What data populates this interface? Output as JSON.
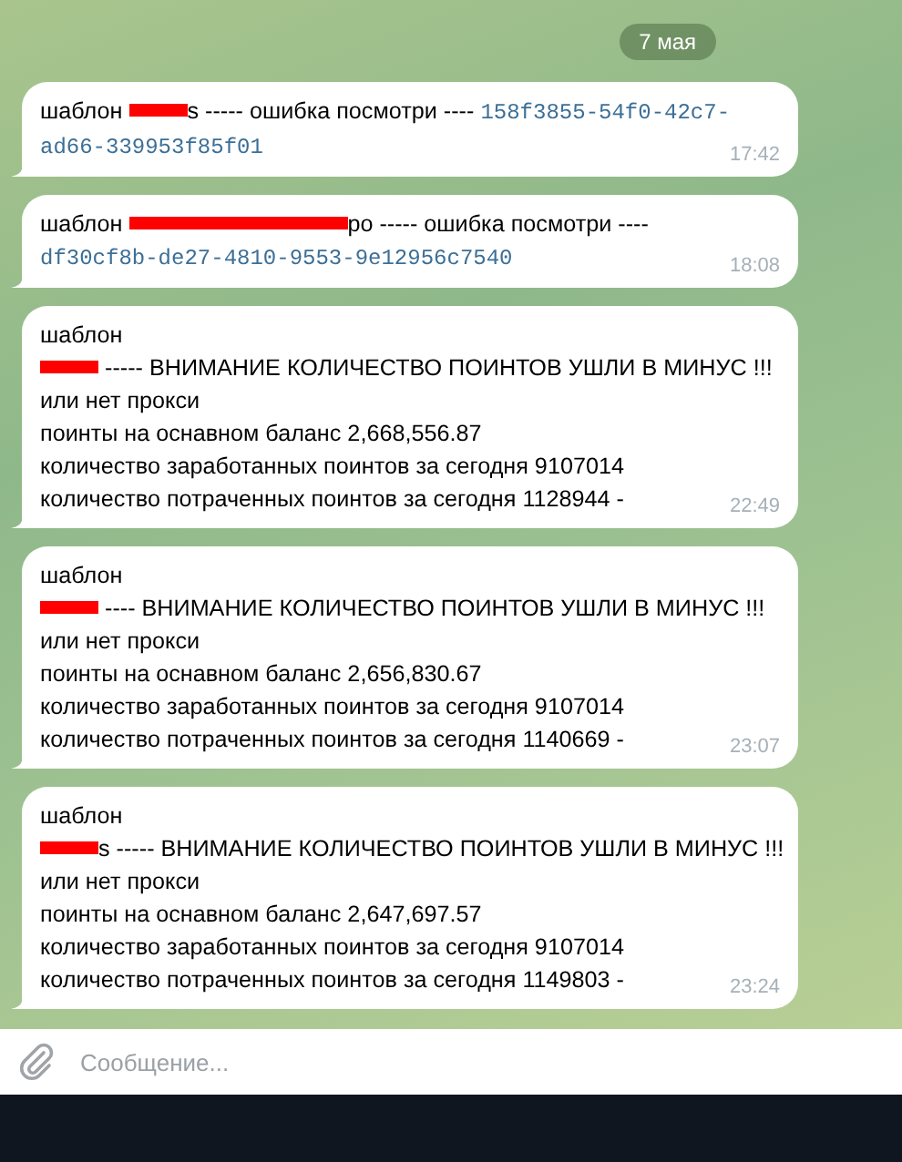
{
  "date_badge": "7 мая",
  "messages": [
    {
      "lines": [
        [
          {
            "kind": "text",
            "text": "шаблон "
          },
          {
            "kind": "blot"
          },
          {
            "kind": "text",
            "text": "s ----- ошибка посмотри ---- "
          },
          {
            "kind": "link",
            "text": "158f3855-54f0-42c7-"
          }
        ],
        [
          {
            "kind": "link",
            "text": "ad66-339953f85f01"
          }
        ]
      ],
      "time": "17:42"
    },
    {
      "lines": [
        [
          {
            "kind": "text",
            "text": "шаблон "
          },
          {
            "kind": "bar"
          },
          {
            "kind": "text",
            "text": "ро ----- ошибка посмотри ----"
          }
        ],
        [
          {
            "kind": "link",
            "text": "df30cf8b-de27-4810-9553-9e12956c7540"
          }
        ]
      ],
      "time": "18:08"
    },
    {
      "lines": [
        [
          {
            "kind": "text",
            "text": "шаблон"
          }
        ],
        [
          {
            "kind": "blot"
          },
          {
            "kind": "text",
            "text": " ----- ВНИМАНИЕ КОЛИЧЕСТВО ПОИНТОВ УШЛИ В МИНУС !!!"
          }
        ],
        [
          {
            "kind": "text",
            "text": "или нет прокси"
          }
        ],
        [
          {
            "kind": "text",
            "text": "поинты на оснавном баланс 2,668,556.87"
          }
        ],
        [
          {
            "kind": "text",
            "text": "количество заработанных поинтов за сегодня 9107014"
          }
        ],
        [
          {
            "kind": "text",
            "text": "количество потраченных поинтов за сегодня 1128944 -"
          }
        ]
      ],
      "time": "22:49"
    },
    {
      "lines": [
        [
          {
            "kind": "text",
            "text": "шаблон"
          }
        ],
        [
          {
            "kind": "blot"
          },
          {
            "kind": "text",
            "text": " ---- ВНИМАНИЕ КОЛИЧЕСТВО ПОИНТОВ УШЛИ В МИНУС !!!"
          }
        ],
        [
          {
            "kind": "text",
            "text": "или нет прокси"
          }
        ],
        [
          {
            "kind": "text",
            "text": "поинты на оснавном баланс 2,656,830.67"
          }
        ],
        [
          {
            "kind": "text",
            "text": "количество заработанных поинтов за сегодня 9107014"
          }
        ],
        [
          {
            "kind": "text",
            "text": "количество потраченных поинтов за сегодня 1140669 -"
          }
        ]
      ],
      "time": "23:07"
    },
    {
      "lines": [
        [
          {
            "kind": "text",
            "text": "шаблон"
          }
        ],
        [
          {
            "kind": "blot"
          },
          {
            "kind": "text",
            "text": "s ----- ВНИМАНИЕ КОЛИЧЕСТВО ПОИНТОВ УШЛИ В МИНУС !!!"
          }
        ],
        [
          {
            "kind": "text",
            "text": "или нет прокси"
          }
        ],
        [
          {
            "kind": "text",
            "text": "поинты на оснавном баланс 2,647,697.57"
          }
        ],
        [
          {
            "kind": "text",
            "text": "количество заработанных поинтов за сегодня 9107014"
          }
        ],
        [
          {
            "kind": "text",
            "text": "количество потраченных поинтов за сегодня 1149803 -"
          }
        ]
      ],
      "time": "23:24"
    }
  ],
  "composer": {
    "placeholder": "Сообщение..."
  }
}
